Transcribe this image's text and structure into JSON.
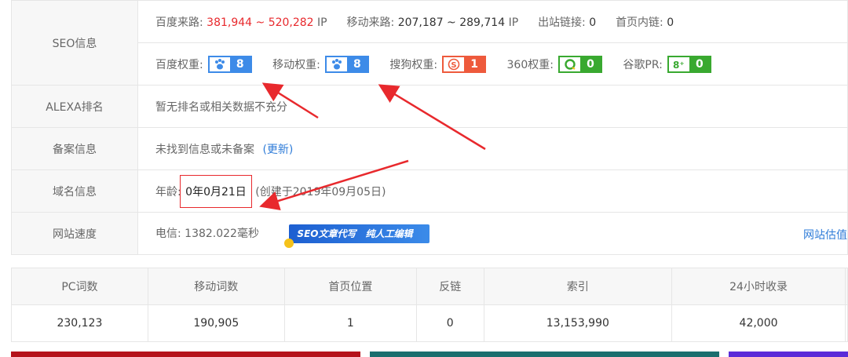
{
  "seo": {
    "label": "SEO信息",
    "baidu_traffic_label": "百度来路:",
    "baidu_traffic_value": "381,944 ~ 520,282",
    "ip1": "IP",
    "mobile_traffic_label": "移动来路:",
    "mobile_traffic_value": "207,187 ~ 289,714",
    "ip2": "IP",
    "outbound_label": "出站链接:",
    "outbound_value": "0",
    "homepage_links_label": "首页内链:",
    "homepage_links_value": "0",
    "weights": [
      {
        "label": "百度权重:",
        "value": "8",
        "icon": "paw-icon",
        "color": "#3d8be8"
      },
      {
        "label": "移动权重:",
        "value": "8",
        "icon": "paw-icon",
        "color": "#3d8be8"
      },
      {
        "label": "搜狗权重:",
        "value": "1",
        "icon": "sogou-icon",
        "color": "#ee5a3c"
      },
      {
        "label": "360权重:",
        "value": "0",
        "icon": "360-icon",
        "color": "#39a930"
      },
      {
        "label": "谷歌PR:",
        "value": "0",
        "icon": "google-plus-icon",
        "color": "#39a930"
      }
    ]
  },
  "alexa": {
    "label": "ALEXA排名",
    "value": "暂无排名或相关数据不充分"
  },
  "icp": {
    "label": "备案信息",
    "value": "未找到信息或未备案",
    "refresh": "(更新)"
  },
  "domain": {
    "label": "域名信息",
    "age_label": "年龄:",
    "age_value": "0年0月21日",
    "created": "(创建于2019年09月05日)"
  },
  "speed": {
    "label": "网站速度",
    "value": "电信: 1382.022毫秒",
    "ad_text_1": "SEO文章代写",
    "ad_text_2": "纯人工编辑",
    "estimate_link": "网站估值"
  },
  "stats": {
    "headers": [
      "PC词数",
      "移动词数",
      "首页位置",
      "反链",
      "索引",
      "24小时收录"
    ],
    "values": [
      "230,123",
      "190,905",
      "1",
      "0",
      "13,153,990",
      "42,000"
    ]
  }
}
